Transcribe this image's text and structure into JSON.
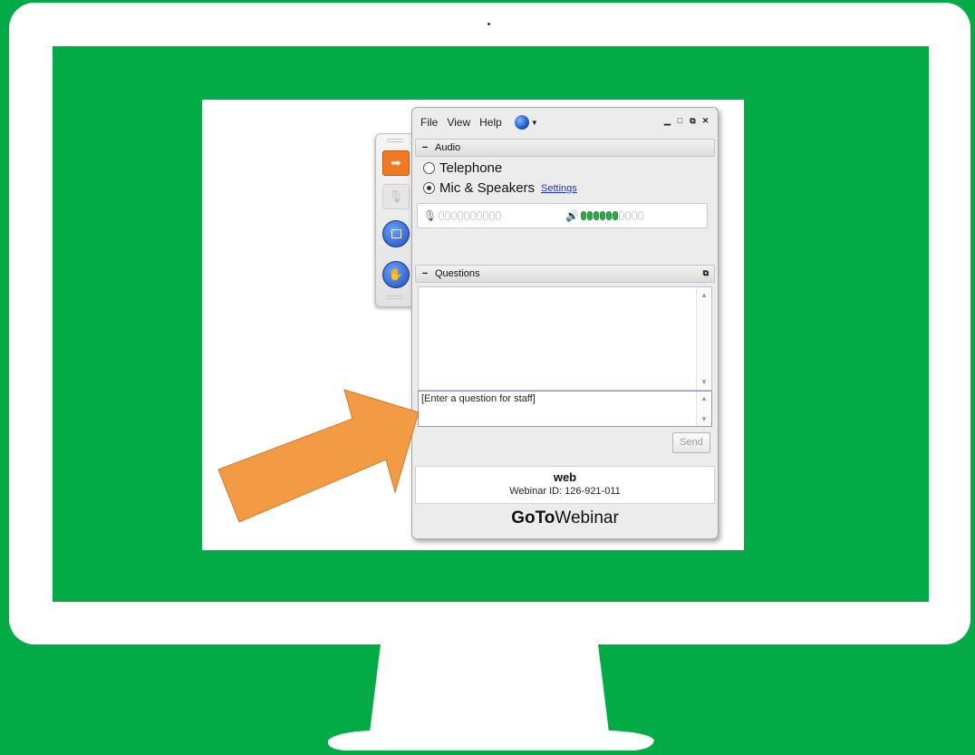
{
  "panel": {
    "menu": [
      "File",
      "View",
      "Help"
    ],
    "window_controls": [
      "minimize-icon",
      "maximize-icon",
      "popout-icon",
      "close-icon"
    ],
    "audio": {
      "header": "Audio",
      "option_telephone": "Telephone",
      "option_mic": "Mic & Speakers",
      "selected": "Mic & Speakers",
      "settings_link": "Settings",
      "mic_level_segments_on": 0,
      "speaker_level_segments_on": 6,
      "segments_total": 10
    },
    "questions": {
      "header": "Questions",
      "input_placeholder": "[Enter a question for staff]",
      "send_label": "Send"
    },
    "webinar": {
      "name": "web",
      "id_text": "Webinar ID: 126-921-011"
    },
    "brand": {
      "bold": "GoTo",
      "regular": "Webinar"
    }
  },
  "colors": {
    "background": "#02ab46",
    "arrow": "#f39a45",
    "grab_tab_accent": "#f07a21",
    "meter_green": "#2ea84a"
  }
}
